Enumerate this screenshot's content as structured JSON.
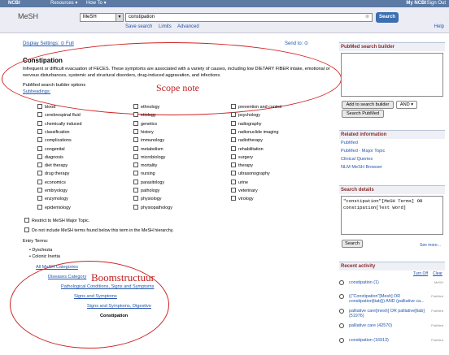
{
  "topbar": {
    "ncbi": "NCBI",
    "resources": "Resources ▾",
    "howto": "How To ▾",
    "mylink": "My NCBI",
    "signout": "Sign Out"
  },
  "header": {
    "title": "MeSH",
    "db": "MeSH",
    "query": "constipation",
    "search_btn": "Search",
    "links": [
      "Save search",
      "Limits",
      "Advanced"
    ],
    "help": "Help"
  },
  "display_settings": "Display Settings: ⊙ Full",
  "send_to": "Send to: ⊙",
  "concept": {
    "title": "Constipation",
    "description": "Infrequent or difficult evacuation of FECES. These symptoms are associated with a variety of causes, including low DIETARY FIBER intake, emotional or nervous disturbances, systemic and structural disorders, drug-induced aggravation, and infections.",
    "builder_options": "PubMed search builder options",
    "subheadings": "Subheadings:"
  },
  "subheadings": {
    "col1": [
      "blood",
      "cerebrospinal fluid",
      "chemically induced",
      "classification",
      "complications",
      "congenital",
      "diagnosis",
      "diet therapy",
      "drug therapy",
      "economics",
      "embryology",
      "enzymology",
      "epidemiology"
    ],
    "col2": [
      "ethnology",
      "etiology",
      "genetics",
      "history",
      "immunology",
      "metabolism",
      "microbiology",
      "mortality",
      "nursing",
      "parasitology",
      "pathology",
      "physiology",
      "physiopathology"
    ],
    "col3": [
      "prevention and control",
      "psychology",
      "radiography",
      "radionuclide imaging",
      "radiotherapy",
      "rehabilitation",
      "surgery",
      "therapy",
      "ultrasonography",
      "urine",
      "veterinary",
      "virology"
    ]
  },
  "options": [
    "Restrict to MeSH Major Topic.",
    "Do not include MeSH terms found below this term in the MeSH hierarchy."
  ],
  "entry": {
    "label": "Entry Terms:",
    "terms": [
      "• Dyschezia",
      "• Colonic Inertia"
    ]
  },
  "tree": [
    "All MeSH Categories",
    "Diseases Category",
    "Pathological Conditions, Signs and Symptoms",
    "Signs and Symptoms",
    "Signs and Symptoms, Digestive",
    "Constipation"
  ],
  "annotations": {
    "scope": "Scope note",
    "tree": "Boomstructuur"
  },
  "sidebar": {
    "builder_title": "PubMed search builder",
    "add_btn": "Add to search builder",
    "and": "AND ▾",
    "search_pubmed": "Search PubMed",
    "related_title": "Related information",
    "related": [
      "PubMed",
      "PubMed - Major Topic",
      "Clinical Queries",
      "NLM MeSH Browser"
    ],
    "details_title": "Search details",
    "details_text": "\"constipation\"[MeSH Terms] OR constipation[Text Word]",
    "search_btn": "Search",
    "see_more": "See more...",
    "recent_title": "Recent activity",
    "turn_off": "Turn Off",
    "clear": "Clear",
    "recent": [
      {
        "text": "constipation (1)",
        "tag": "MeSH"
      },
      {
        "text": "((\"Constipation\"[Mesh] OR constipation[tiab])) AND (palliative ca...",
        "tag": "PubMed"
      },
      {
        "text": "palliative care[mesh] OR palliative[tiab] (51976)",
        "tag": "PubMed"
      },
      {
        "text": "palliative care (42570)",
        "tag": "PubMed"
      },
      {
        "text": "constipation (16913)",
        "tag": "PubMed"
      }
    ]
  }
}
